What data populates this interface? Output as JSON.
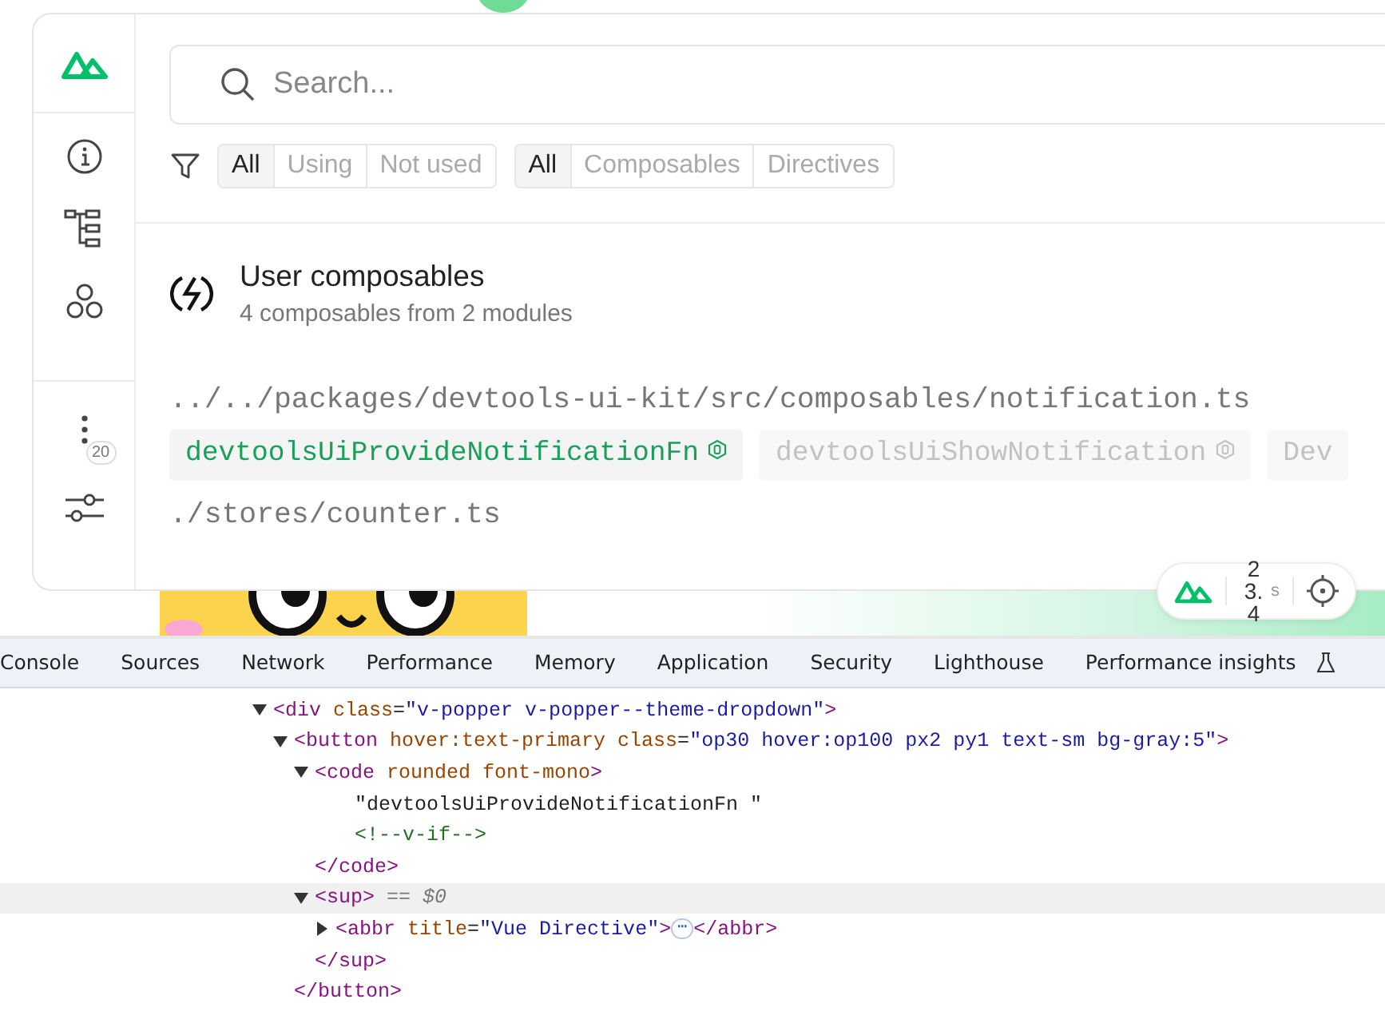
{
  "sidebar": {
    "items": [
      {
        "kind": "info",
        "selected": false
      },
      {
        "kind": "tree",
        "selected": false
      },
      {
        "kind": "components",
        "selected": false
      }
    ],
    "more_badge": "20"
  },
  "search": {
    "placeholder": "Search..."
  },
  "filters": [
    [
      {
        "label": "All",
        "selected": true
      },
      {
        "label": "Using",
        "selected": false
      },
      {
        "label": "Not used",
        "selected": false
      }
    ],
    [
      {
        "label": "All",
        "selected": true
      },
      {
        "label": "Composables",
        "selected": false
      },
      {
        "label": "Directives",
        "selected": false
      }
    ]
  ],
  "section": {
    "title": "User composables",
    "subtitle": "4 composables from 2 modules"
  },
  "modules": [
    {
      "path": "../../packages/devtools-ui-kit/src/composables/notification.ts",
      "items": [
        {
          "name": "devtoolsUiProvideNotificationFn",
          "highlighted": true,
          "directive": true
        },
        {
          "name": "devtoolsUiShowNotification",
          "highlighted": false,
          "directive": true
        },
        {
          "name": "Dev",
          "highlighted": false,
          "directive": false
        }
      ]
    },
    {
      "path": "./stores/counter.ts"
    }
  ],
  "timer": {
    "value": "23.4",
    "unit": "s"
  },
  "devtools_tabs": [
    {
      "label": "Console",
      "selected": false
    },
    {
      "label": "Sources",
      "selected": false
    },
    {
      "label": "Network",
      "selected": false
    },
    {
      "label": "Performance",
      "selected": false
    },
    {
      "label": "Memory",
      "selected": false
    },
    {
      "label": "Application",
      "selected": false
    },
    {
      "label": "Security",
      "selected": false
    },
    {
      "label": "Lighthouse",
      "selected": false
    },
    {
      "label": "Performance insights",
      "selected": false,
      "experimental": true
    }
  ],
  "dom_tree": [
    {
      "kind": "element",
      "expanded": true,
      "selected": false,
      "line": [
        {
          "kind": "tag",
          "text": "<div"
        },
        {
          "kind": "attr",
          "text": " class"
        },
        {
          "kind": "punct",
          "text": "="
        },
        {
          "kind": "value",
          "text": "\"v-popper v-popper--theme-dropdown\""
        },
        {
          "kind": "tag",
          "text": ">"
        }
      ],
      "children": [
        {
          "kind": "element",
          "expanded": true,
          "selected": false,
          "line": [
            {
              "kind": "tag",
              "text": "<button"
            },
            {
              "kind": "attr",
              "text": " hover:text-primary class"
            },
            {
              "kind": "punct",
              "text": "="
            },
            {
              "kind": "value",
              "text": "\"op30 hover:op100 px2 py1 text-sm bg-gray:5\""
            },
            {
              "kind": "tag",
              "text": ">"
            }
          ],
          "close": [
            {
              "kind": "tag",
              "text": "</button>"
            }
          ],
          "children": [
            {
              "kind": "element",
              "expanded": true,
              "selected": false,
              "line": [
                {
                  "kind": "tag",
                  "text": "<code"
                },
                {
                  "kind": "attr",
                  "text": " rounded font-mono"
                },
                {
                  "kind": "tag",
                  "text": ">"
                }
              ],
              "close": [
                {
                  "kind": "tag",
                  "text": "</code>"
                }
              ],
              "children": [
                {
                  "kind": "text",
                  "selected": false,
                  "line": [
                    {
                      "kind": "text",
                      "text": "\"devtoolsUiProvideNotificationFn \""
                    }
                  ]
                },
                {
                  "kind": "comment",
                  "selected": false,
                  "line": [
                    {
                      "kind": "comment",
                      "text": "<!--v-if-->"
                    }
                  ]
                }
              ]
            },
            {
              "kind": "element",
              "expanded": true,
              "selected": true,
              "line": [
                {
                  "kind": "tag",
                  "text": "<sup>"
                },
                {
                  "kind": "note",
                  "text": " == $0"
                }
              ],
              "close": [
                {
                  "kind": "tag",
                  "text": "</sup>"
                }
              ],
              "children": [
                {
                  "kind": "element",
                  "expanded": false,
                  "selected": false,
                  "line": [
                    {
                      "kind": "tag",
                      "text": "<abbr"
                    },
                    {
                      "kind": "attr",
                      "text": " title"
                    },
                    {
                      "kind": "punct",
                      "text": "="
                    },
                    {
                      "kind": "value",
                      "text": "\"Vue Directive\""
                    },
                    {
                      "kind": "tag",
                      "text": ">"
                    },
                    {
                      "kind": "more",
                      "text": "⋯"
                    },
                    {
                      "kind": "tag",
                      "text": "</abbr>"
                    }
                  ]
                }
              ]
            }
          ]
        }
      ]
    }
  ]
}
